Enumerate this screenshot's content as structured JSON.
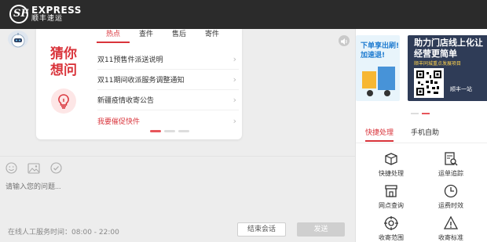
{
  "brand": {
    "name_en": "EXPRESS",
    "name_cn": "顺丰速运",
    "logo_glyph": "SF",
    "color": "#d9343b"
  },
  "card": {
    "title": "猜你想问",
    "tabs": [
      "热点",
      "查件",
      "售后",
      "寄件"
    ],
    "items": [
      "双11预售件派送说明",
      "双11期间收派服务调整通知",
      "新疆疫情收寄公告",
      "我要催促快件"
    ]
  },
  "input": {
    "placeholder": "请输入您的问题..."
  },
  "footer": {
    "hours": "在线人工服务时间：08:00 - 22:00",
    "end_label": "结束会话",
    "send_label": "发送"
  },
  "banners": {
    "a_text": "下单享出刷!加速退!",
    "b_title": "助力门店线上化让经营更简单",
    "b_sub": "顺丰同城重点发展项目",
    "b_brand": "顺丰一站"
  },
  "right_tabs": [
    "快捷处理",
    "手机自助"
  ],
  "services": [
    "快捷处理",
    "运单追踪",
    "网点查询",
    "运费时效",
    "收寄范围",
    "收寄标准"
  ],
  "icons": [
    "logo-icon",
    "robot-avatar-icon",
    "speaker-icon",
    "bulb-icon",
    "emoji-icon",
    "image-icon",
    "check-icon"
  ]
}
